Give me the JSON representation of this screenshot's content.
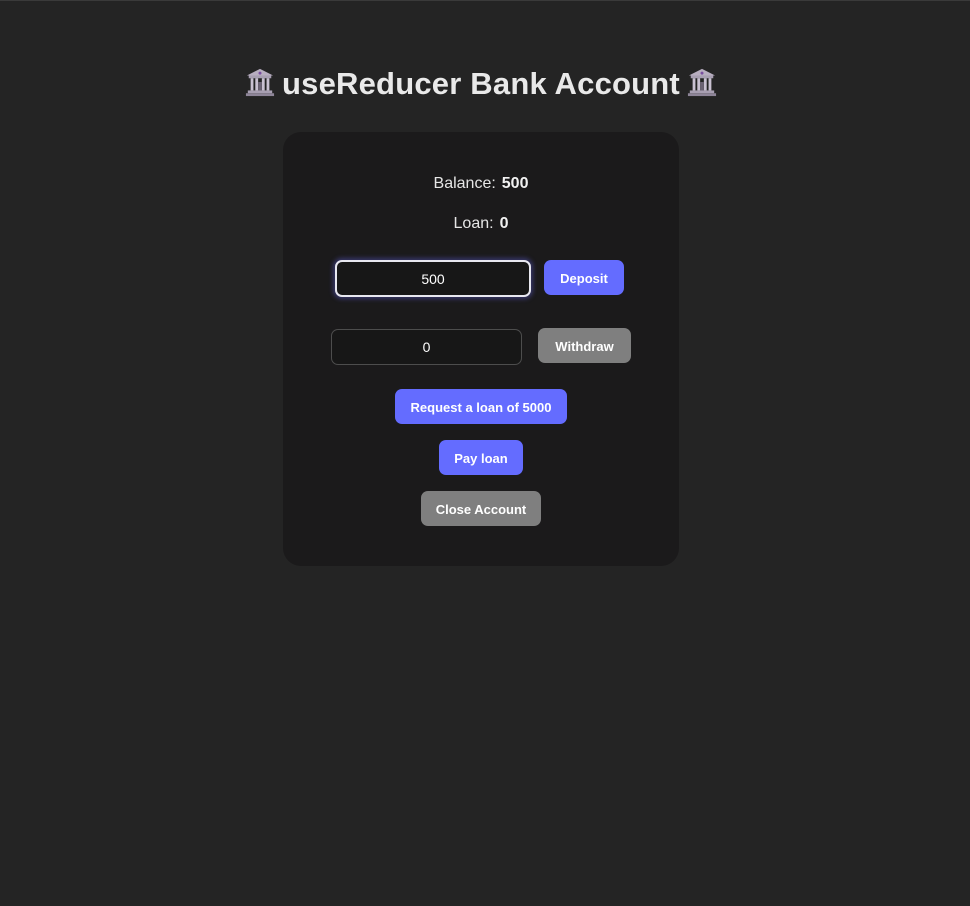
{
  "header": {
    "title": "useReducer Bank Account",
    "left_icon": "bank-icon",
    "right_icon": "bank-icon"
  },
  "account": {
    "balance_label": "Balance:",
    "balance_value": "500",
    "loan_label": "Loan:",
    "loan_value": "0"
  },
  "deposit": {
    "input_value": "500",
    "button_label": "Deposit"
  },
  "withdraw": {
    "input_value": "0",
    "button_label": "Withdraw"
  },
  "actions": {
    "request_loan_label": "Request a loan of 5000",
    "pay_loan_label": "Pay loan",
    "close_account_label": "Close Account"
  },
  "colors": {
    "page_background": "#242424",
    "card_background": "#1b1a1b",
    "primary_button": "#646cff",
    "secondary_button": "#7f7f7f"
  }
}
